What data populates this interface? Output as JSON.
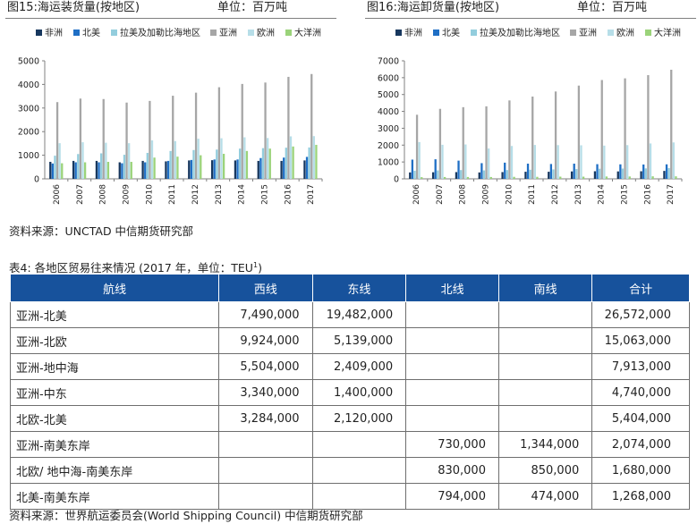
{
  "legend": [
    {
      "name": "非洲",
      "color": "#17375e"
    },
    {
      "name": "北美",
      "color": "#1f6fc5"
    },
    {
      "name": "拉美及加勒比海地区",
      "color": "#93cddd"
    },
    {
      "name": "亚洲",
      "color": "#a6a6a6"
    },
    {
      "name": "欧洲",
      "color": "#b7dee8"
    },
    {
      "name": "大洋洲",
      "color": "#9bd37a"
    }
  ],
  "chart_data": [
    {
      "type": "bar",
      "title": "图15:海运装货量(按地区)",
      "unit": "单位：百万吨",
      "categories": [
        "2006",
        "2007",
        "2008",
        "2009",
        "2010",
        "2011",
        "2012",
        "2013",
        "2014",
        "2015",
        "2016",
        "2017"
      ],
      "ylim": [
        0,
        5000
      ],
      "yticks": [
        0,
        1000,
        2000,
        3000,
        4000,
        5000
      ],
      "series": [
        {
          "name": "非洲",
          "values": [
            720,
            760,
            760,
            700,
            760,
            740,
            780,
            790,
            780,
            760,
            760,
            780
          ]
        },
        {
          "name": "北美",
          "values": [
            650,
            700,
            700,
            660,
            700,
            760,
            800,
            820,
            820,
            880,
            900,
            930
          ]
        },
        {
          "name": "拉美及加勒比海地区",
          "values": [
            980,
            1050,
            1080,
            1020,
            1100,
            1180,
            1220,
            1240,
            1280,
            1300,
            1320,
            1330
          ]
        },
        {
          "name": "亚洲",
          "values": [
            3250,
            3400,
            3380,
            3230,
            3300,
            3520,
            3650,
            3880,
            4020,
            4080,
            4320,
            4440
          ]
        },
        {
          "name": "欧洲",
          "values": [
            1510,
            1550,
            1530,
            1510,
            1630,
            1600,
            1700,
            1720,
            1760,
            1730,
            1800,
            1810
          ]
        },
        {
          "name": "大洋洲",
          "values": [
            660,
            700,
            720,
            720,
            900,
            940,
            1000,
            1060,
            1180,
            1280,
            1370,
            1440
          ]
        }
      ]
    },
    {
      "type": "bar",
      "title": "图16:海运卸货量(按地区)",
      "unit": "单位：百万吨",
      "categories": [
        "2006",
        "2007",
        "2008",
        "2009",
        "2010",
        "2011",
        "2012",
        "2013",
        "2014",
        "2015",
        "2016",
        "2017"
      ],
      "ylim": [
        0,
        7000
      ],
      "yticks": [
        0,
        1000,
        2000,
        3000,
        4000,
        5000,
        6000,
        7000
      ],
      "series": [
        {
          "name": "非洲",
          "values": [
            380,
            390,
            400,
            380,
            400,
            420,
            420,
            440,
            450,
            440,
            450,
            470
          ]
        },
        {
          "name": "北美",
          "values": [
            1140,
            1160,
            1080,
            930,
            960,
            900,
            880,
            900,
            870,
            860,
            850,
            860
          ]
        },
        {
          "name": "拉美及加勒比海地区",
          "values": [
            480,
            500,
            520,
            500,
            520,
            540,
            560,
            580,
            600,
            610,
            620,
            640
          ]
        },
        {
          "name": "亚洲",
          "values": [
            3800,
            4150,
            4250,
            4300,
            4650,
            4880,
            5180,
            5530,
            5860,
            5960,
            6150,
            6470
          ]
        },
        {
          "name": "欧洲",
          "values": [
            2180,
            2020,
            2040,
            1800,
            1950,
            2010,
            2000,
            1990,
            1970,
            2000,
            2100,
            2160
          ]
        },
        {
          "name": "大洋洲",
          "values": [
            100,
            110,
            110,
            110,
            120,
            120,
            130,
            130,
            140,
            140,
            150,
            150
          ]
        }
      ]
    },
    {
      "type": "table",
      "title": "表4: 各地区贸易往来情况 (2017 年，单位：TEU",
      "title_sup": "1",
      "title_end": ")",
      "columns": [
        "航线",
        "西线",
        "东线",
        "北线",
        "南线",
        "合计"
      ],
      "rows": [
        [
          "亚洲-北美",
          "7,490,000",
          "19,482,000",
          "",
          "",
          "26,572,000"
        ],
        [
          "亚洲-北欧",
          "9,924,000",
          "5,139,000",
          "",
          "",
          "15,063,000"
        ],
        [
          "亚洲-地中海",
          "5,504,000",
          "2,409,000",
          "",
          "",
          "7,913,000"
        ],
        [
          "亚洲-中东",
          "3,340,000",
          "1,400,000",
          "",
          "",
          "4,740,000"
        ],
        [
          "北欧-北美",
          "3,284,000",
          "2,120,000",
          "",
          "",
          "5,404,000"
        ],
        [
          "亚洲-南美东岸",
          "",
          "",
          "730,000",
          "1,344,000",
          "2,074,000"
        ],
        [
          "北欧/ 地中海-南美东岸",
          "",
          "",
          "830,000",
          "850,000",
          "1,680,000"
        ],
        [
          "北美-南美东岸",
          "",
          "",
          "794,000",
          "474,000",
          "1,268,000"
        ]
      ]
    }
  ],
  "sources": {
    "charts": "资料来源：UNCTAD  中信期货研究部",
    "table": "资料来源：世界航运委员会(World Shipping Council)  中信期货研究部"
  }
}
